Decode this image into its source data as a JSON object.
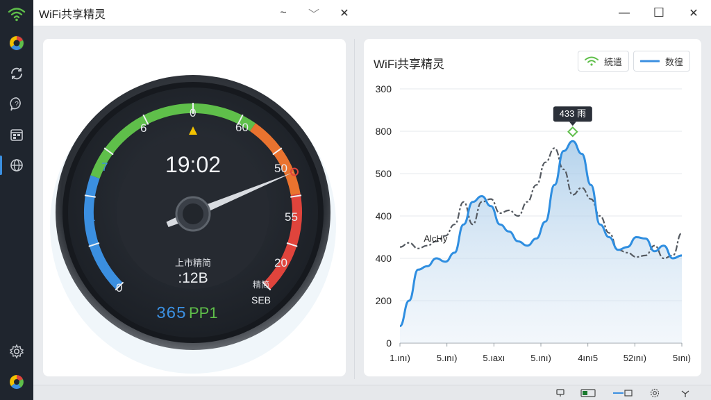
{
  "app": {
    "title": "WiFi共享精灵"
  },
  "titlebar": {
    "dropdown_glyph": "~",
    "chevron_glyph": "﹀",
    "close_small_glyph": "✕",
    "min_glyph": "—",
    "max_glyph": "☐",
    "close_glyph": "✕"
  },
  "gauge": {
    "time": "19:02",
    "label": "上市精简",
    "reading": ":12B",
    "speed": "365",
    "speed_unit": "PP1",
    "sub_label": "精简",
    "sub_value": "SEB",
    "needle_fraction": 0.75,
    "ticks": [
      "0",
      "1",
      "1",
      "7",
      "6",
      "0",
      "60",
      "50",
      "55",
      "20"
    ],
    "colors": {
      "green": "#5fbf4a",
      "blue": "#3b8fe0",
      "orange": "#e9732f",
      "red": "#e0443c",
      "yellow": "#f2c200"
    }
  },
  "chart": {
    "header": "WiFi共享精灵",
    "legend": [
      {
        "label": "続遣",
        "icon": "wifi-icon"
      },
      {
        "label": "数徨",
        "icon": "line-icon"
      }
    ]
  },
  "chart_data": {
    "type": "line",
    "title": "WiFi共享精灵",
    "y_ticks": [
      "300",
      "800",
      "500",
      "400",
      "400",
      "200",
      "0"
    ],
    "x_ticks": [
      "1.ını)",
      "5.ını)",
      "5.ıaxı",
      "5.ını)",
      "4ını5",
      "52ını)",
      "5ını)"
    ],
    "tooltip": "433 雨",
    "annotation": "AlcHy",
    "series": [
      {
        "values": [
          60,
          150,
          260,
          272,
          300,
          288,
          320,
          420,
          500,
          520,
          485,
          420,
          395,
          360,
          345,
          370,
          430,
          560,
          680,
          715,
          670,
          560,
          420,
          375,
          330,
          340,
          375,
          370,
          325,
          345,
          300,
          310
        ]
      },
      {
        "values": [
          340,
          355,
          335,
          345,
          360,
          380,
          420,
          500,
          420,
          500,
          510,
          460,
          470,
          450,
          500,
          560,
          640,
          690,
          615,
          525,
          550,
          510,
          450,
          390,
          330,
          320,
          305,
          310,
          345,
          300,
          310,
          390
        ]
      }
    ],
    "x_count": 32,
    "ylim": [
      0,
      900
    ]
  }
}
